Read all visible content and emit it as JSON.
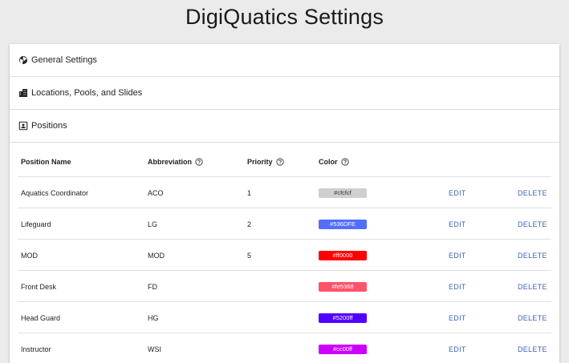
{
  "page": {
    "title": "DigiQuatics Settings"
  },
  "sections": [
    {
      "label": "General Settings",
      "icon": "globe-icon"
    },
    {
      "label": "Locations, Pools, and Slides",
      "icon": "buildings-icon"
    },
    {
      "label": "Positions",
      "icon": "contact-card-icon"
    }
  ],
  "positions": {
    "columns": {
      "name": "Position Name",
      "abbreviation": "Abbreviation",
      "priority": "Priority",
      "color": "Color"
    },
    "help_icon": "help-circle-icon",
    "rows": [
      {
        "name": "Aquatics Coordinator",
        "abbreviation": "ACO",
        "priority": "1",
        "color": "#cfcfcf",
        "edit": "EDIT",
        "delete": "DELETE"
      },
      {
        "name": "Lifeguard",
        "abbreviation": "LG",
        "priority": "2",
        "color": "#536DFE",
        "edit": "EDIT",
        "delete": "DELETE"
      },
      {
        "name": "MOD",
        "abbreviation": "MOD",
        "priority": "5",
        "color": "#ff0000",
        "edit": "EDIT",
        "delete": "DELETE"
      },
      {
        "name": "Front Desk",
        "abbreviation": "FD",
        "priority": "",
        "color": "#fe5368",
        "edit": "EDIT",
        "delete": "DELETE"
      },
      {
        "name": "Head Guard",
        "abbreviation": "HG",
        "priority": "",
        "color": "#5200ff",
        "edit": "EDIT",
        "delete": "DELETE"
      },
      {
        "name": "Instructor",
        "abbreviation": "WSI",
        "priority": "",
        "color": "#cc00ff",
        "edit": "EDIT",
        "delete": "DELETE"
      }
    ]
  },
  "colors": {
    "action": "#3f64b8",
    "background": "#ebebeb"
  }
}
